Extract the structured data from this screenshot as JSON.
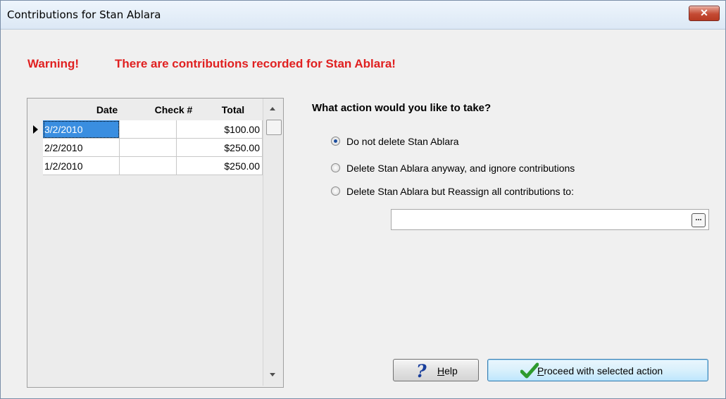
{
  "window": {
    "title": "Contributions for Stan Ablara",
    "close_glyph": "✕"
  },
  "warning": {
    "label": "Warning!",
    "message": "There are contributions recorded for Stan Ablara!"
  },
  "grid": {
    "columns": [
      "Date",
      "Check #",
      "Total"
    ],
    "rows": [
      {
        "date": "3/2/2010",
        "check": "",
        "total": "$100.00",
        "selected": true
      },
      {
        "date": "2/2/2010",
        "check": "",
        "total": "$250.00",
        "selected": false
      },
      {
        "date": "1/2/2010",
        "check": "",
        "total": "$250.00",
        "selected": false
      }
    ]
  },
  "action": {
    "question": "What action would you like to take?",
    "options": [
      {
        "label": "Do not delete Stan Ablara",
        "checked": true
      },
      {
        "label": "Delete Stan Ablara anyway, and ignore contributions",
        "checked": false
      },
      {
        "label": "Delete Stan Ablara but Reassign all contributions to:",
        "checked": false
      }
    ],
    "reassign_value": "",
    "browse_glyph": "..."
  },
  "buttons": {
    "help_icon": "question-icon",
    "help_mnemonic": "H",
    "help_rest": "elp",
    "proceed_icon": "checkmark-icon",
    "proceed_mnemonic": "P",
    "proceed_rest": "roceed with selected action"
  },
  "colors": {
    "warning": "#e02020",
    "selection": "#3a8ee0",
    "radio_dot": "#1d4e9e",
    "check_green": "#2e9a2e"
  }
}
